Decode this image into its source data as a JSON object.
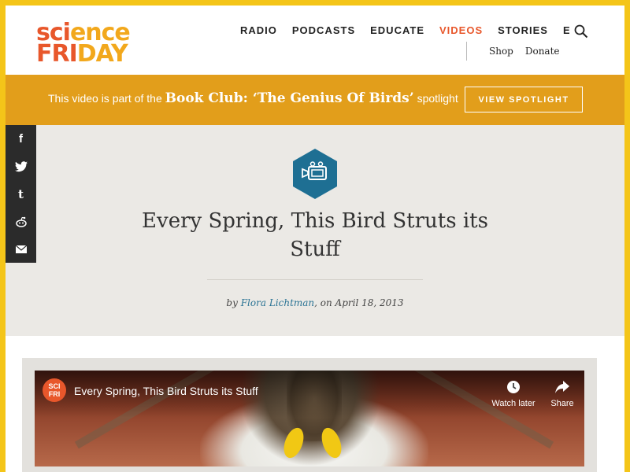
{
  "logo": {
    "line1": [
      "sci",
      "ence"
    ],
    "line2": [
      "FRI",
      "DAY"
    ]
  },
  "nav": {
    "items": [
      {
        "label": "RADIO"
      },
      {
        "label": "PODCASTS"
      },
      {
        "label": "EDUCATE"
      },
      {
        "label": "VIDEOS",
        "active": true
      },
      {
        "label": "STORIES"
      },
      {
        "label": "EVENTS"
      }
    ],
    "secondary": [
      "Shop",
      "Donate"
    ]
  },
  "banner": {
    "prefix": "This video is part of the",
    "highlight": "Book Club: ‘The Genius Of Birds’",
    "suffix": "spotlight",
    "button": "VIEW SPOTLIGHT"
  },
  "article": {
    "icon": "video-camera-icon",
    "title": "Every Spring, This Bird Struts its Stuff",
    "byline_prefix": "by",
    "author": "Flora Lichtman",
    "date_text": ", on April 18, 2013"
  },
  "social": [
    "facebook-icon",
    "twitter-icon",
    "tumblr-icon",
    "reddit-icon",
    "email-icon"
  ],
  "video": {
    "channel_logo": [
      "SCI",
      "FRI"
    ],
    "title": "Every Spring, This Bird Struts its Stuff",
    "watch_later": "Watch later",
    "share": "Share"
  },
  "colors": {
    "accent_orange": "#e8572b",
    "frame_yellow": "#f4c519",
    "banner_gold": "#e29e1b",
    "link_blue": "#2a7394"
  }
}
